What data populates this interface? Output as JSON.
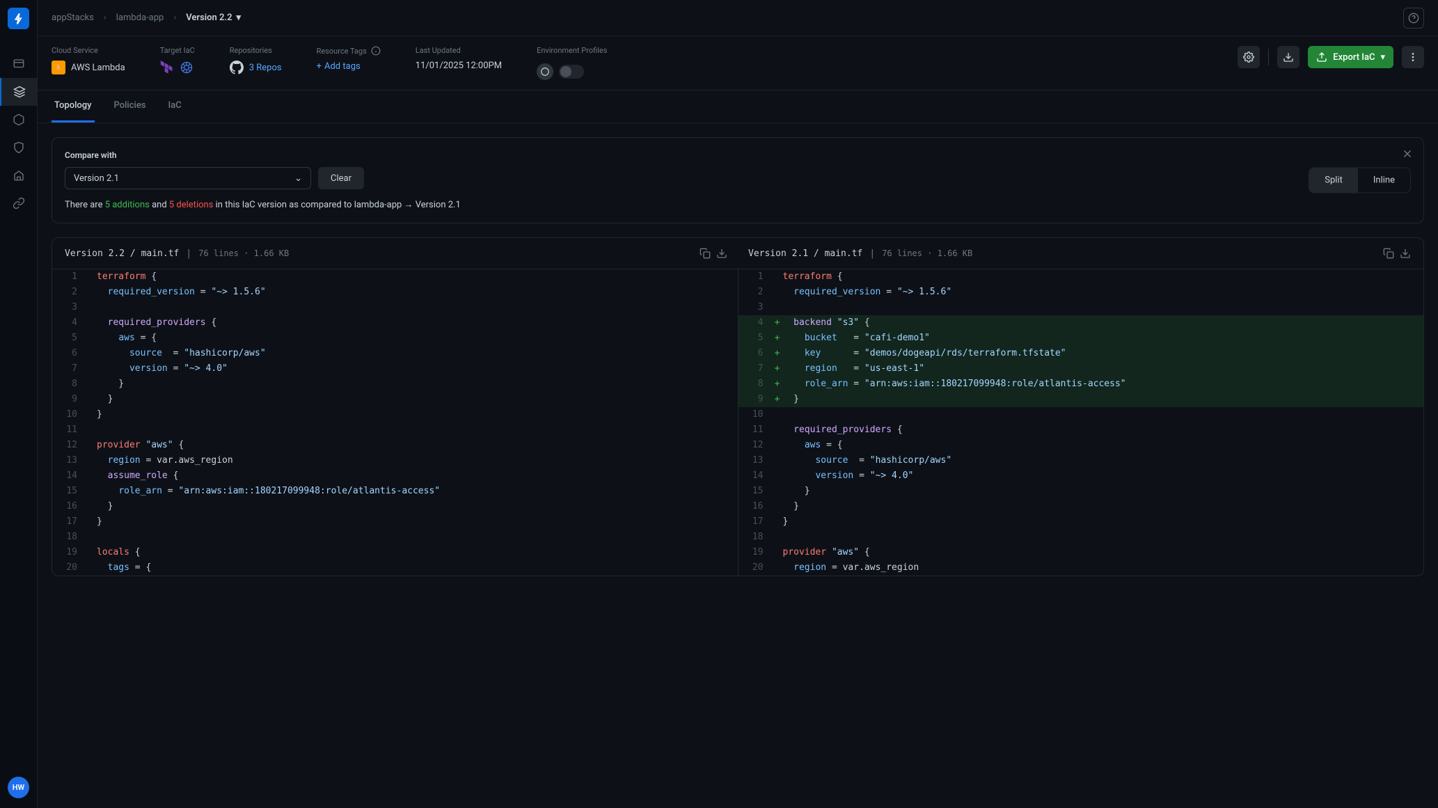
{
  "breadcrumb": {
    "item1": "appStacks",
    "item2": "lambda-app",
    "current": "Version 2.2"
  },
  "header": {
    "cloud_service": {
      "label": "Cloud Service",
      "value": "AWS Lambda"
    },
    "target_iac": {
      "label": "Target IaC"
    },
    "repositories": {
      "label": "Repositories",
      "value": "3 Repos"
    },
    "resource_tags": {
      "label": "Resource Tags",
      "value": "Add tags"
    },
    "last_updated": {
      "label": "Last Updated",
      "value": "11/01/2025 12:00PM"
    },
    "env_profiles": {
      "label": "Environment Profiles"
    },
    "export_button": "Export IaC"
  },
  "tabs": {
    "topology": "Topology",
    "policies": "Policies",
    "iac": "IaC"
  },
  "compare": {
    "label": "Compare with",
    "selected": "Version 2.1",
    "clear": "Clear",
    "split": "Split",
    "inline": "Inline",
    "summary_prefix": "There are ",
    "additions": "5 additions",
    "summary_and": " and ",
    "deletions": "5 deletions",
    "summary_suffix": " in this IaC version as compared to lambda-app → Version 2.1"
  },
  "left_file": {
    "path": "Version 2.2 / main.tf",
    "meta": "76 lines  ·  1.66 KB"
  },
  "right_file": {
    "path": "Version 2.1 / main.tf",
    "meta": "76 lines  ·  1.66 KB"
  },
  "left_code": [
    {
      "n": "1",
      "added": false,
      "html": "<span class='tok-kw'>terraform</span> {"
    },
    {
      "n": "2",
      "added": false,
      "html": "  <span class='tok-prop'>required_version</span> <span class='tok-op'>=</span> <span class='tok-str'>\"~> 1.5.6\"</span>"
    },
    {
      "n": "3",
      "added": false,
      "html": ""
    },
    {
      "n": "4",
      "added": false,
      "html": "  <span class='tok-fn'>required_providers</span> {"
    },
    {
      "n": "5",
      "added": false,
      "html": "    <span class='tok-prop'>aws</span> <span class='tok-op'>=</span> {"
    },
    {
      "n": "6",
      "added": false,
      "html": "      <span class='tok-prop'>source</span>  <span class='tok-op'>=</span> <span class='tok-str'>\"hashicorp/aws\"</span>"
    },
    {
      "n": "7",
      "added": false,
      "html": "      <span class='tok-prop'>version</span> <span class='tok-op'>=</span> <span class='tok-str'>\"~> 4.0\"</span>"
    },
    {
      "n": "8",
      "added": false,
      "html": "    }"
    },
    {
      "n": "9",
      "added": false,
      "html": "  }"
    },
    {
      "n": "10",
      "added": false,
      "html": "}"
    },
    {
      "n": "11",
      "added": false,
      "html": ""
    },
    {
      "n": "12",
      "added": false,
      "html": "<span class='tok-kw'>provider</span> <span class='tok-str'>\"aws\"</span> {"
    },
    {
      "n": "13",
      "added": false,
      "html": "  <span class='tok-prop'>region</span> <span class='tok-op'>=</span> var.aws_region"
    },
    {
      "n": "14",
      "added": false,
      "html": "  <span class='tok-fn'>assume_role</span> {"
    },
    {
      "n": "15",
      "added": false,
      "html": "    <span class='tok-prop'>role_arn</span> <span class='tok-op'>=</span> <span class='tok-str'>\"arn:aws:iam::180217099948:role/atlantis-access\"</span>"
    },
    {
      "n": "16",
      "added": false,
      "html": "  }"
    },
    {
      "n": "17",
      "added": false,
      "html": "}"
    },
    {
      "n": "18",
      "added": false,
      "html": ""
    },
    {
      "n": "19",
      "added": false,
      "html": "<span class='tok-kw'>locals</span> {"
    },
    {
      "n": "20",
      "added": false,
      "html": "  <span class='tok-prop'>tags</span> <span class='tok-op'>=</span> {"
    }
  ],
  "right_code": [
    {
      "n": "1",
      "added": false,
      "html": "<span class='tok-kw'>terraform</span> {"
    },
    {
      "n": "2",
      "added": false,
      "html": "  <span class='tok-prop'>required_version</span> <span class='tok-op'>=</span> <span class='tok-str'>\"~> 1.5.6\"</span>"
    },
    {
      "n": "3",
      "added": false,
      "html": ""
    },
    {
      "n": "4",
      "added": true,
      "html": "  <span class='tok-fn'>backend</span> <span class='tok-str'>\"s3\"</span> {"
    },
    {
      "n": "5",
      "added": true,
      "html": "    <span class='tok-prop'>bucket</span>   <span class='tok-op'>=</span> <span class='tok-str'>\"cafi-demo1\"</span>"
    },
    {
      "n": "6",
      "added": true,
      "html": "    <span class='tok-prop'>key</span>      <span class='tok-op'>=</span> <span class='tok-str'>\"demos/dogeapi/rds/terraform.tfstate\"</span>"
    },
    {
      "n": "7",
      "added": true,
      "html": "    <span class='tok-prop'>region</span>   <span class='tok-op'>=</span> <span class='tok-str'>\"us-east-1\"</span>"
    },
    {
      "n": "8",
      "added": true,
      "html": "    <span class='tok-prop'>role_arn</span> <span class='tok-op'>=</span> <span class='tok-str'>\"arn:aws:iam::180217099948:role/atlantis-access\"</span>"
    },
    {
      "n": "9",
      "added": true,
      "html": "  }"
    },
    {
      "n": "10",
      "added": false,
      "html": ""
    },
    {
      "n": "11",
      "added": false,
      "html": "  <span class='tok-fn'>required_providers</span> {"
    },
    {
      "n": "12",
      "added": false,
      "html": "    <span class='tok-prop'>aws</span> <span class='tok-op'>=</span> {"
    },
    {
      "n": "13",
      "added": false,
      "html": "      <span class='tok-prop'>source</span>  <span class='tok-op'>=</span> <span class='tok-str'>\"hashicorp/aws\"</span>"
    },
    {
      "n": "14",
      "added": false,
      "html": "      <span class='tok-prop'>version</span> <span class='tok-op'>=</span> <span class='tok-str'>\"~> 4.0\"</span>"
    },
    {
      "n": "15",
      "added": false,
      "html": "    }"
    },
    {
      "n": "16",
      "added": false,
      "html": "  }"
    },
    {
      "n": "17",
      "added": false,
      "html": "}"
    },
    {
      "n": "18",
      "added": false,
      "html": ""
    },
    {
      "n": "19",
      "added": false,
      "html": "<span class='tok-kw'>provider</span> <span class='tok-str'>\"aws\"</span> {"
    },
    {
      "n": "20",
      "added": false,
      "html": "  <span class='tok-prop'>region</span> <span class='tok-op'>=</span> var.aws_region"
    }
  ],
  "avatar": "HW"
}
